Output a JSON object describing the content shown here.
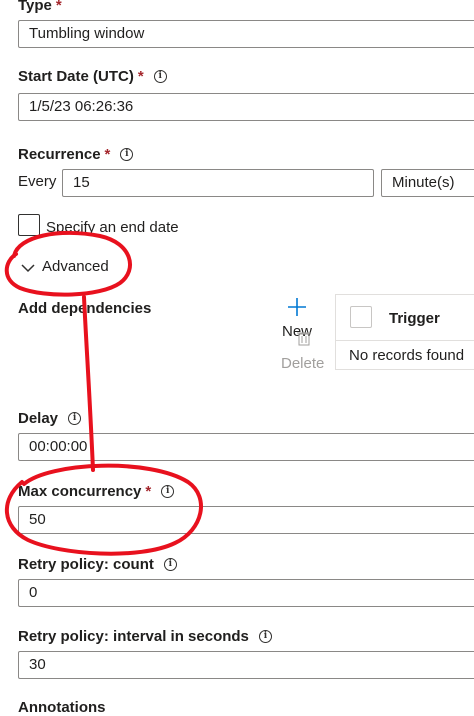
{
  "type": {
    "label": "Type",
    "required_mark": "*",
    "value": "Tumbling window"
  },
  "start_date": {
    "label": "Start Date (UTC)",
    "required_mark": "*",
    "value": "1/5/23 06:26:36"
  },
  "recurrence": {
    "label": "Recurrence",
    "required_mark": "*",
    "every_label": "Every",
    "interval": "15",
    "unit": "Minute(s)"
  },
  "end_date": {
    "label": "Specify an end date",
    "checked": false
  },
  "advanced": {
    "label": "Advanced",
    "expanded": true
  },
  "dependencies": {
    "label": "Add dependencies",
    "new_label": "New",
    "delete_label": "Delete",
    "column_trigger": "Trigger",
    "empty_text": "No records found"
  },
  "delay": {
    "label": "Delay",
    "value": "00:00:00"
  },
  "max_concurrency": {
    "label": "Max concurrency",
    "required_mark": "*",
    "value": "50"
  },
  "retry_count": {
    "label": "Retry policy: count",
    "value": "0"
  },
  "retry_interval": {
    "label": "Retry policy: interval in seconds",
    "value": "30"
  },
  "annotations": {
    "label": "Annotations"
  },
  "icons": {
    "info": "i",
    "chevron": "chevron-down-icon",
    "plus": "+"
  },
  "colors": {
    "annotation_red": "#e8111e",
    "required_red": "#a4262c",
    "accent": "#0078d4"
  }
}
